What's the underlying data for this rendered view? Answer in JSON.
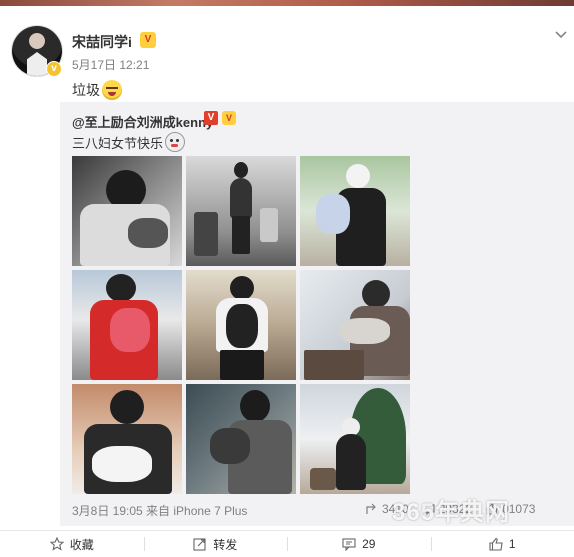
{
  "post": {
    "user_name": "宋喆同学i",
    "vip_badge": "V",
    "meta": "5月17日 12:21",
    "text": "垃圾"
  },
  "repost": {
    "author": "@至上励合刘洲成kenny",
    "text": "三八妇女节快乐",
    "date_source": "3月8日 19:05 来自 iPhone 7 Plus",
    "stats": {
      "share_count": "3410",
      "comment_count": "29322",
      "like_count": "01073"
    },
    "photos": [
      {
        "name": "photo-1"
      },
      {
        "name": "photo-2"
      },
      {
        "name": "photo-3"
      },
      {
        "name": "photo-4"
      },
      {
        "name": "photo-5"
      },
      {
        "name": "photo-6"
      },
      {
        "name": "photo-7"
      },
      {
        "name": "photo-8"
      },
      {
        "name": "photo-9"
      }
    ]
  },
  "actions": {
    "favorite_label": "收藏",
    "repost_label": "转发",
    "comment_count": "29",
    "like_count": "1"
  },
  "watermark": "365年典网",
  "colors": {
    "link": "#333333",
    "meta": "#808080",
    "repost_bg": "#f2f2f5",
    "accent": "#fa7d3c"
  }
}
